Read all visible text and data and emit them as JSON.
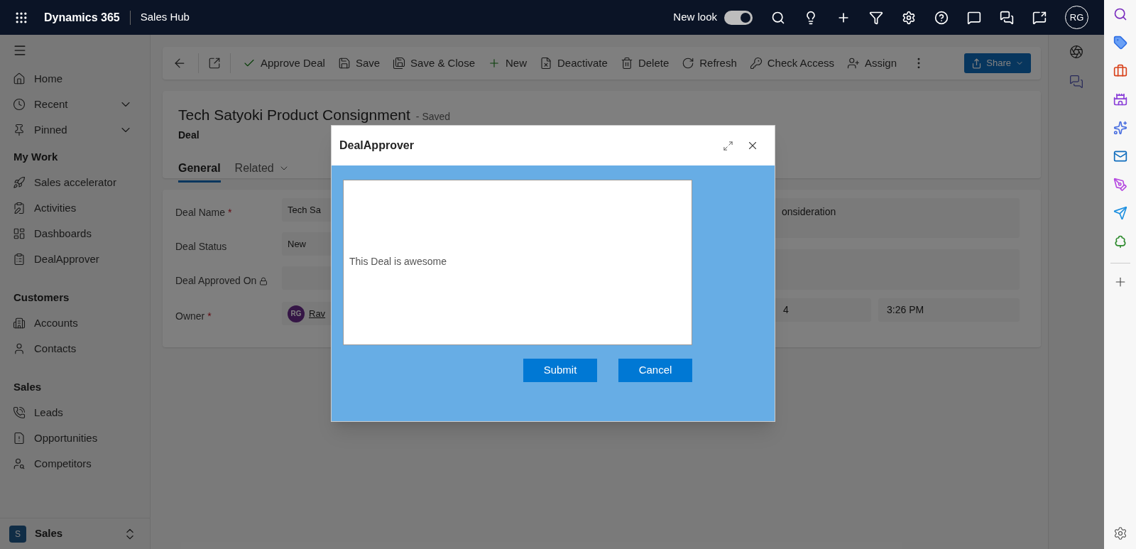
{
  "top_bar": {
    "app_name": "Dynamics 365",
    "area": "Sales Hub",
    "new_look_label": "New look",
    "new_look_on": true,
    "avatar": "RG"
  },
  "sidebar": {
    "items": [
      {
        "kind": "item",
        "label": "Home"
      },
      {
        "kind": "expandable",
        "label": "Recent"
      },
      {
        "kind": "expandable",
        "label": "Pinned"
      },
      {
        "kind": "section",
        "label": "My Work"
      },
      {
        "kind": "item",
        "label": "Sales accelerator"
      },
      {
        "kind": "item",
        "label": "Activities"
      },
      {
        "kind": "item",
        "label": "Dashboards"
      },
      {
        "kind": "item",
        "label": "DealApprover"
      },
      {
        "kind": "section",
        "label": "Customers"
      },
      {
        "kind": "item",
        "label": "Accounts"
      },
      {
        "kind": "item",
        "label": "Contacts"
      },
      {
        "kind": "section",
        "label": "Sales"
      },
      {
        "kind": "item",
        "label": "Leads"
      },
      {
        "kind": "item",
        "label": "Opportunities"
      },
      {
        "kind": "item",
        "label": "Competitors"
      }
    ],
    "area_switcher": {
      "badge": "S",
      "label": "Sales"
    }
  },
  "command_bar": {
    "buttons": [
      "Approve Deal",
      "Save",
      "Save & Close",
      "New",
      "Deactivate",
      "Delete",
      "Refresh",
      "Check Access",
      "Assign"
    ],
    "share": "Share"
  },
  "record": {
    "title": "Tech Satyoki Product Consignment",
    "status": "- Saved",
    "entity": "Deal",
    "tabs": [
      {
        "label": "General",
        "selected": true
      },
      {
        "label": "Related",
        "selected": false
      }
    ]
  },
  "fields": [
    {
      "label": "Deal Name",
      "required_mark": "*",
      "locked": false,
      "value": "Tech Sa"
    },
    {
      "label": "Deal Status",
      "locked": false,
      "value": "New"
    },
    {
      "label": "Deal Approved On",
      "locked": true
    },
    {
      "label": "Owner",
      "required_mark": "*",
      "locked": false,
      "value": "Rav",
      "avatar": "RG"
    }
  ],
  "right_fields": {
    "first": "onsideration",
    "date": "4",
    "time": "3:26 PM"
  },
  "dialog": {
    "title": "DealApprover",
    "comment": "This Deal is awesome",
    "buttons": [
      "Submit",
      "Cancel"
    ]
  }
}
